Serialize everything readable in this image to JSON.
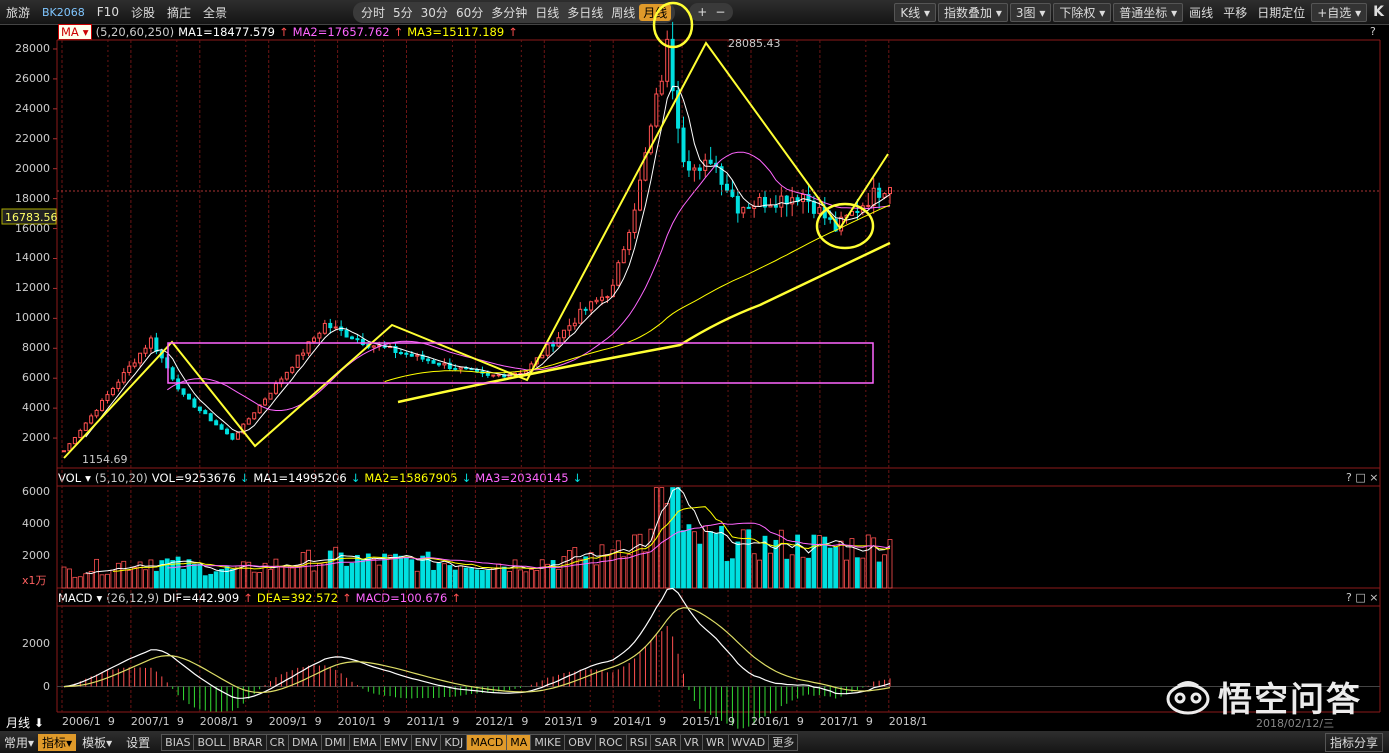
{
  "topbar": {
    "left_items": [
      "旅游",
      "BK2068",
      "F10",
      "诊股",
      "摘庄",
      "全景"
    ],
    "periods": [
      "分时",
      "5分",
      "30分",
      "60分",
      "多分钟",
      "日线",
      "多日线",
      "周线",
      "月线"
    ],
    "active_period": "月线",
    "right_items": [
      "K线",
      "指数叠加",
      "3图",
      "下除权",
      "普通坐标",
      "画线",
      "平移",
      "日期定位",
      "+自选"
    ],
    "plus": "+",
    "minus": "−",
    "k_icon": "K"
  },
  "price_panel": {
    "indicator_name": "MA",
    "params": "(5,20,60,250)",
    "ma1": "MA1=18477.579",
    "ma2": "MA2=17657.762",
    "ma3": "MA3=15117.189",
    "arrows": [
      "↑",
      "↑",
      "↑"
    ],
    "current_price": "16783.56",
    "high_label": "28085.43",
    "low_label": "1154.69",
    "yticks": [
      "28000",
      "26000",
      "24000",
      "22000",
      "20000",
      "18000",
      "16000",
      "14000",
      "12000",
      "10000",
      "8000",
      "6000",
      "4000",
      "2000"
    ],
    "help": "?"
  },
  "volume_panel": {
    "indicator_name": "VOL",
    "params": "(5,10,20)",
    "vol": "VOL=9253676",
    "ma1": "MA1=14995206",
    "ma2": "MA2=15867905",
    "ma3": "MA3=20340145",
    "arrows": [
      "↓",
      "↓",
      "↓",
      "↓"
    ],
    "yticks": [
      "6000",
      "4000",
      "2000"
    ],
    "unit": "x1万",
    "help": "? □ ×"
  },
  "macd_panel": {
    "indicator_name": "MACD",
    "params": "(26,12,9)",
    "dif": "DIF=442.909",
    "dea": "DEA=392.572",
    "macd": "MACD=100.676",
    "arrows": [
      "↑",
      "↑",
      "↑"
    ],
    "yticks": [
      "2000",
      "0"
    ],
    "help": "? □ ×"
  },
  "date_axis": {
    "period_label": "月线",
    "labels": [
      "2006/1",
      "9",
      "2007/1",
      "9",
      "2008/1",
      "9",
      "2009/1",
      "9",
      "2010/1",
      "9",
      "2011/1",
      "9",
      "2012/1",
      "9",
      "2013/1",
      "9",
      "2014/1",
      "9",
      "2015/1",
      "9",
      "2016/1",
      "9",
      "2017/1",
      "9",
      "2018/1"
    ],
    "date_readout": "2018/02/12/三"
  },
  "bottombar": {
    "common": "常用",
    "indicator": "指标",
    "template": "模板",
    "settings": "设置",
    "tabs": [
      "BIAS",
      "BOLL",
      "BRAR",
      "CR",
      "DMA",
      "DMI",
      "EMA",
      "EMV",
      "ENV",
      "KDJ",
      "MACD",
      "MA",
      "MIKE",
      "OBV",
      "ROC",
      "RSI",
      "SAR",
      "VR",
      "WR",
      "WVAD",
      "更多"
    ],
    "active_tabs": [
      "MACD",
      "MA"
    ],
    "share": "指标分享"
  },
  "watermark": "悟空问答",
  "colors": {
    "up": "#ff5050",
    "down": "#00e0e0",
    "ma_white": "#ffffff",
    "ma_yellow": "#ffff00",
    "ma_pink": "#ff66ff",
    "box": "#ff66ff",
    "annotation": "#ffff33",
    "accent": "#e09a2a"
  }
}
